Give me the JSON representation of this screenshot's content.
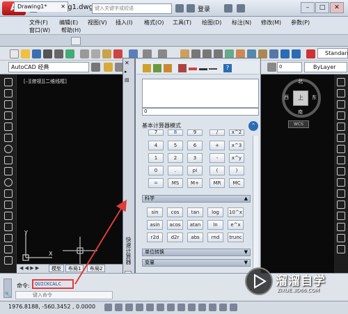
{
  "titlebar": {
    "app_button": "A",
    "doc_title": "Drawing1.dwg",
    "search_placeholder": "键入关键字或短语",
    "login": "登录",
    "minimize": "–",
    "maximize": "□",
    "close": "✕"
  },
  "menu": {
    "row1": [
      "文件(F)",
      "编辑(E)",
      "视图(V)",
      "插入(I)",
      "格式(O)",
      "工具(T)",
      "绘图(D)",
      "标注(N)",
      "修改(M)",
      "参数(P)"
    ],
    "row2": [
      "窗口(W)",
      "帮助(H)"
    ]
  },
  "doc_tab": {
    "label": "Drawing1*",
    "close": "✕"
  },
  "toolbar2": {
    "workspace": "AutoCAD 经典",
    "layer": "0",
    "linetype": "ByLayer",
    "style": "Standard"
  },
  "canvas": {
    "view_label": "[–][俯视][二维线框]",
    "ucs_y": "Y",
    "ucs_x": "X"
  },
  "viewcube": {
    "top": "上",
    "north": "北",
    "south": "南",
    "east": "东",
    "west": "西",
    "wcs": "WCS"
  },
  "layout_tabs": [
    "模型",
    "布局1",
    "布局2"
  ],
  "calc": {
    "strip_title": "快速计算器",
    "input_value": "0",
    "basic_section": "基本计算器模式",
    "keypad": [
      [
        "7",
        "8",
        "9",
        "/",
        "x^2"
      ],
      [
        "4",
        "5",
        "6",
        "+",
        "x^3"
      ],
      [
        "1",
        "2",
        "3",
        "-",
        "x^y"
      ],
      [
        "0",
        ".",
        "pi",
        "(",
        ")"
      ],
      [
        "=",
        "MS",
        "M+",
        "MR",
        "MC"
      ]
    ],
    "science_section": "科学",
    "science_keys": [
      [
        "sin",
        "cos",
        "tan",
        "log",
        "10^x"
      ],
      [
        "asin",
        "acos",
        "atan",
        "ln",
        "e^x"
      ],
      [
        "r2d",
        "d2r",
        "abs",
        "rnd",
        "trunc"
      ]
    ],
    "units_section": "单位转换",
    "vars_section": "变量"
  },
  "command": {
    "label": "命令:",
    "value": "QUICKCALC",
    "prompt": "键入命令"
  },
  "status": {
    "coords": "1976.8188,  -560.3452 , 0.0000"
  },
  "watermark": {
    "title": "溜溜自学",
    "subtitle": "ZIXUE.3D66.COM"
  },
  "colors": {
    "highlight": "#e23b3b",
    "command_text": "#1b4fa0",
    "canvas": "#0a0a0a"
  }
}
